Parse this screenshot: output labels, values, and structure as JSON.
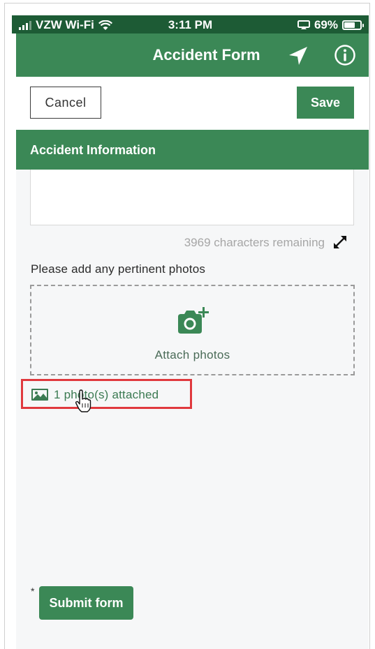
{
  "status_bar": {
    "carrier": "VZW Wi-Fi",
    "time": "3:11 PM",
    "battery_percent": "69%",
    "battery_level": 0.69
  },
  "nav": {
    "title": "Accident Form",
    "location_icon": "location-arrow-icon",
    "info_icon": "info-icon"
  },
  "toolbar": {
    "cancel_label": "Cancel",
    "save_label": "Save"
  },
  "section": {
    "title": "Accident Information"
  },
  "description_field": {
    "value": "",
    "chars_remaining": "3969 characters remaining",
    "expand_icon": "expand-arrows-icon"
  },
  "photos": {
    "prompt": "Please add any pertinent photos",
    "attach_label": "Attach photos",
    "attach_icon": "camera-add-icon",
    "attached_text": "1 photo(s) attached",
    "attached_icon": "image-icon"
  },
  "footer": {
    "required_mark": "*",
    "submit_label": "Submit form"
  },
  "colors": {
    "status_bar": "#1d5b35",
    "brand_green": "#3b8856",
    "highlight_red": "#e0393e",
    "background": "#f6f7f8"
  }
}
